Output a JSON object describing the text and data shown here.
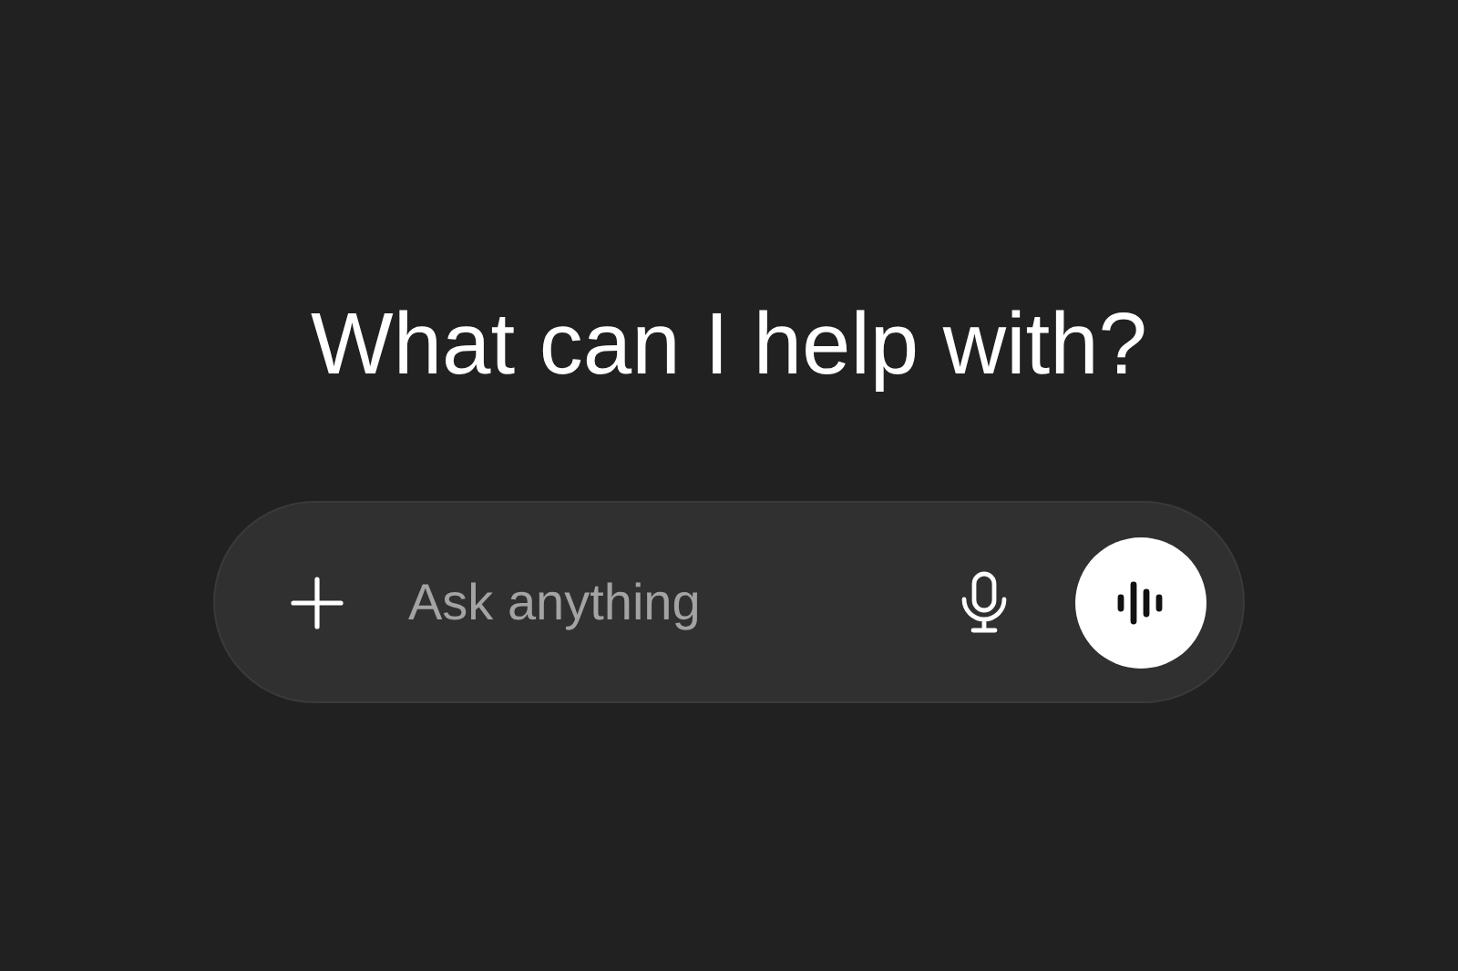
{
  "heading": "What can I help with?",
  "composer": {
    "placeholder": "Ask anything"
  }
}
